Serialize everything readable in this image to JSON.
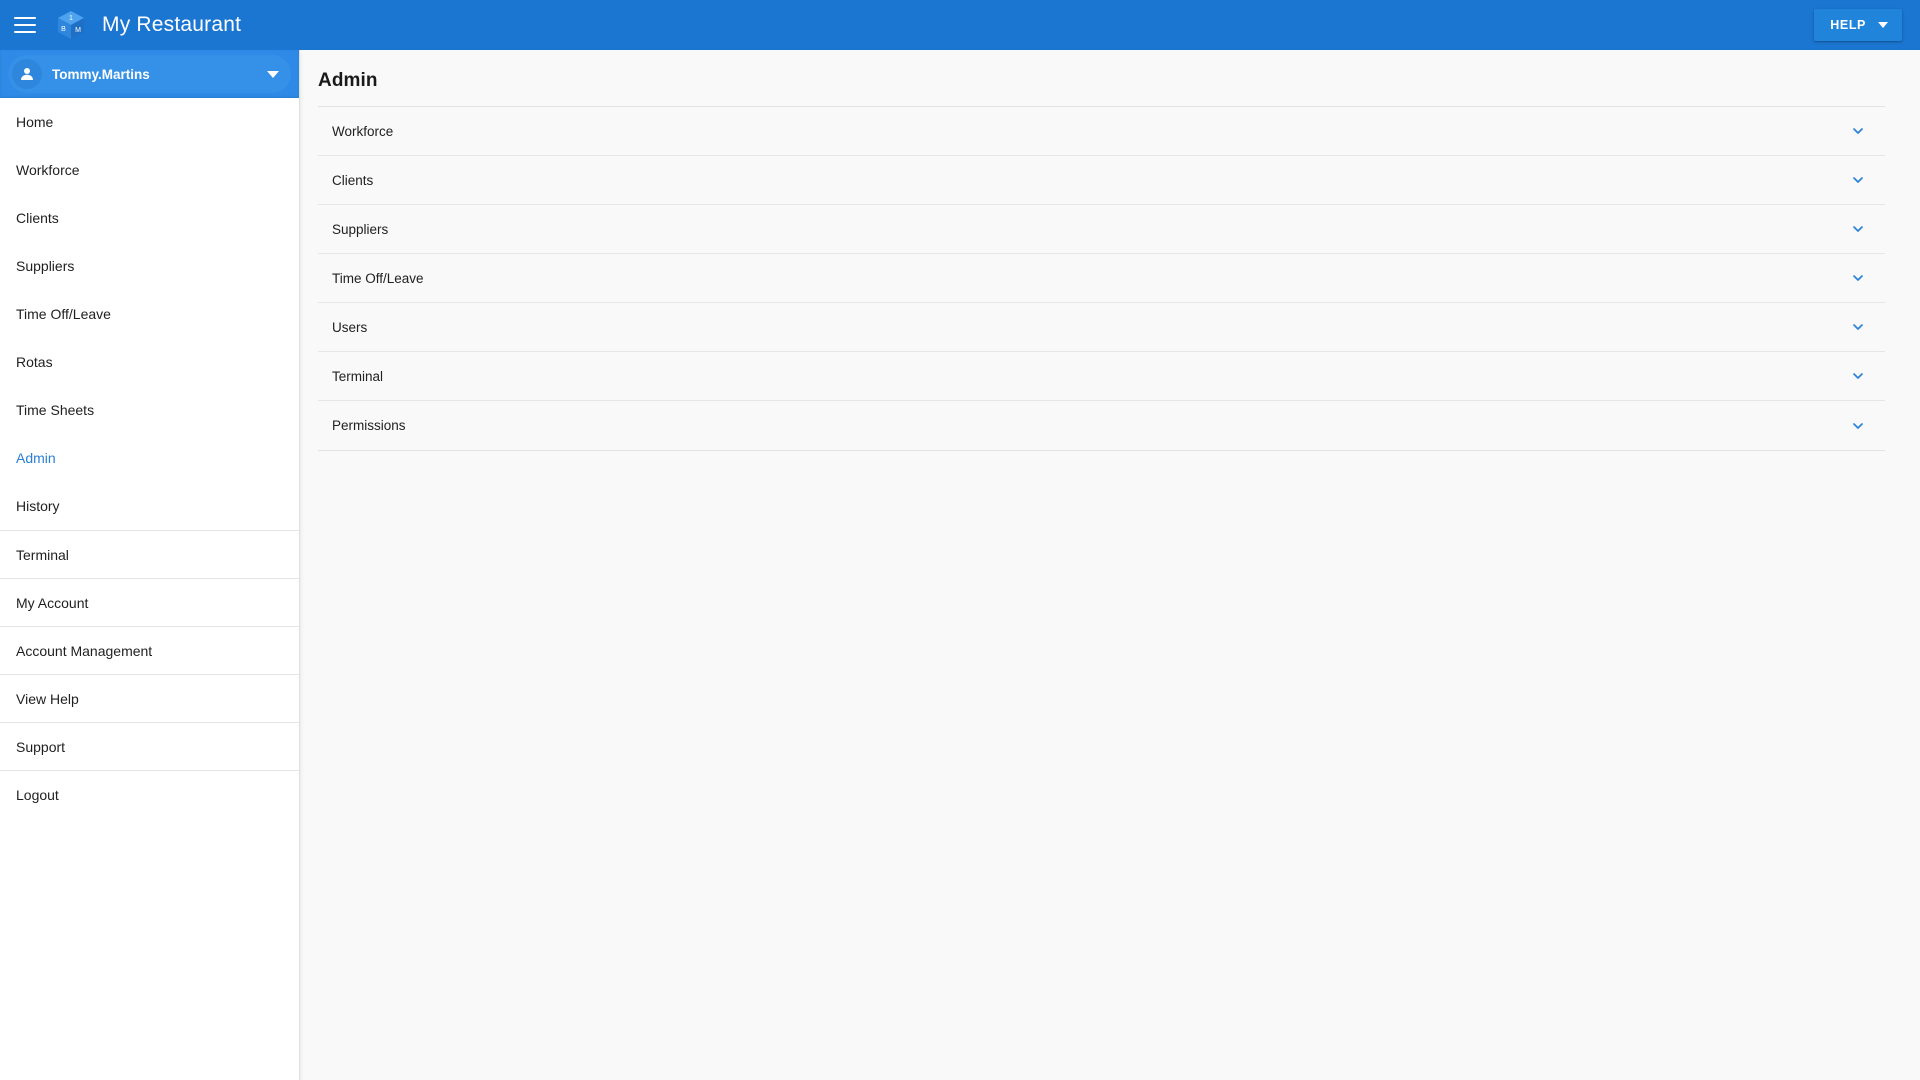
{
  "appbar": {
    "menu_icon": "hamburger-menu-icon",
    "logo_icon": "cube-logo-icon",
    "logo_faces": {
      "top": "1",
      "left": "B",
      "right": "M"
    },
    "title": "My Restaurant",
    "help_label": "HELP",
    "help_caret_icon": "caret-down-icon",
    "bg_color": "#1b76d1"
  },
  "sidebar": {
    "user": {
      "name": "Tommy.Martins",
      "avatar_icon": "person-avatar-icon",
      "caret_icon": "caret-down-icon",
      "chip_color": "#3591e8"
    },
    "items": [
      {
        "label": "Home",
        "active": false,
        "divided": false
      },
      {
        "label": "Workforce",
        "active": false,
        "divided": false
      },
      {
        "label": "Clients",
        "active": false,
        "divided": false
      },
      {
        "label": "Suppliers",
        "active": false,
        "divided": false
      },
      {
        "label": "Time Off/Leave",
        "active": false,
        "divided": false
      },
      {
        "label": "Rotas",
        "active": false,
        "divided": false
      },
      {
        "label": "Time Sheets",
        "active": false,
        "divided": false
      },
      {
        "label": "Admin",
        "active": true,
        "divided": false
      },
      {
        "label": "History",
        "active": false,
        "divided": false
      },
      {
        "label": "Terminal",
        "active": false,
        "divided": true
      },
      {
        "label": "My Account",
        "active": false,
        "divided": true
      },
      {
        "label": "Account Management",
        "active": false,
        "divided": true
      },
      {
        "label": "View Help",
        "active": false,
        "divided": true
      },
      {
        "label": "Support",
        "active": false,
        "divided": true
      },
      {
        "label": "Logout",
        "active": false,
        "divided": true
      }
    ],
    "active_color": "#2b7fd4"
  },
  "main": {
    "page_title": "Admin",
    "accordion": [
      {
        "label": "Workforce",
        "expanded": false,
        "chevron_icon": "chevron-down-icon"
      },
      {
        "label": "Clients",
        "expanded": false,
        "chevron_icon": "chevron-down-icon"
      },
      {
        "label": "Suppliers",
        "expanded": false,
        "chevron_icon": "chevron-down-icon"
      },
      {
        "label": "Time Off/Leave",
        "expanded": false,
        "chevron_icon": "chevron-down-icon"
      },
      {
        "label": "Users",
        "expanded": false,
        "chevron_icon": "chevron-down-icon"
      },
      {
        "label": "Terminal",
        "expanded": false,
        "chevron_icon": "chevron-down-icon"
      },
      {
        "label": "Permissions",
        "expanded": false,
        "chevron_icon": "chevron-down-icon"
      }
    ],
    "chevron_color": "#2b82dd",
    "bg_color": "#f9f9f9"
  }
}
